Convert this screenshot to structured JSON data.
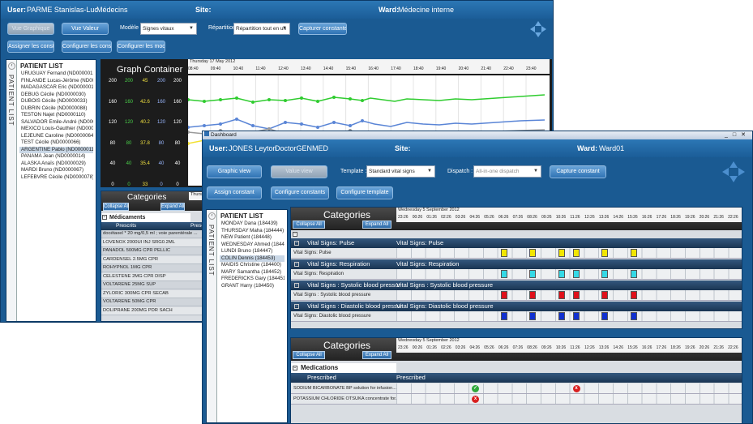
{
  "back": {
    "user_label": "User:",
    "user_value": "PARME Stanislas-Luc",
    "role": "Médecins",
    "site_label": "Site:",
    "ward_label": "Ward:",
    "ward_value": "Médecine interne",
    "btn_graph": "Vue Graphique",
    "btn_value": "Vue Valeur",
    "modele_label": "Modèle :",
    "modele_value": "Signes vitaux",
    "repartition_label": "Répartition",
    "repartition_value": "Répartition tout en un",
    "btn_capture": "Capturer constante",
    "btn_assign": "Assigner les constantes",
    "btn_config_const": "Configurer les constantes",
    "btn_config_models": "Configurer les modèles",
    "patient_tab": "PATIENT LIST",
    "patient_list_title": "PATIENT LIST",
    "patients": [
      "URUGUAY Fernand (ND0000012)",
      "FINLANDE Lucas-Jérôme (ND0000015)",
      "MADAGASCAR Eric (ND0000018)",
      "DEBUG Cécile (ND0000030)",
      "DUBOIS Cécile (ND0000033)",
      "DUBRIN Cécile (ND0000088)",
      "TESTON Najet (ND0000110)",
      "SALVADOR Emile-André (ND0000001)",
      "MEXICO Louis-Gauthier (ND0000013)",
      "LEJEUNE Caroline (ND0000064)",
      "TEST Cécile (ND0000066)",
      "ARGENTINE Pablo (ND0000011)",
      "PANAMA Jean (ND0000014)",
      "ALASKA Anaïs (ND0000029)",
      "MARDI Bruno (ND0000067)",
      "LEFEBVRE Cécile (ND0000078)"
    ],
    "selected_patient": 11,
    "graph_title": "Graph Container",
    "graph_date": "Thursday 17 May 2012",
    "hours": [
      "08:40",
      "09:40",
      "10:40",
      "11:40",
      "12:40",
      "13:40",
      "14:40",
      "15:40",
      "16:40",
      "17:40",
      "18:40",
      "19:40",
      "20:40",
      "21:40",
      "22:40",
      "23:40"
    ],
    "axis_rows": [
      [
        "200",
        "200",
        "45",
        "200",
        "200"
      ],
      [
        "160",
        "160",
        "42.6",
        "160",
        "160"
      ],
      [
        "120",
        "120",
        "40.2",
        "120",
        "120"
      ],
      [
        "80",
        "80",
        "37.8",
        "80",
        "80"
      ],
      [
        "40",
        "40",
        "35.4",
        "40",
        "40"
      ],
      [
        "0",
        "0",
        "33",
        "0",
        "0"
      ]
    ],
    "categories_title": "Categories",
    "collapse_all": "Collapse All",
    "expand_all": "Expand All",
    "cat_date": "Thursday",
    "medicaments_header": "Médicaments",
    "col_prescrits": "Prescrits",
    "col_prescrits2": "Prescrits",
    "meds": [
      "docétaxel * 20 mg/0,5 ml ; voie parentérale ...",
      "LOVENOX 2000UI INJ SRG0.2ML",
      "PANADOL 500MG CPR PELLIC",
      "CARDENSEL 2.5MG CPR",
      "ROHYPNOL 1MG CPR",
      "CELESTENE 2MG CPR DISP",
      "VOLTARENE 25MG SUP",
      "ZYLORIC 300MG CPR SECAB",
      "VOLTARENE 50MG CPR",
      "DOLIPRANE 200MG PDR SACH"
    ]
  },
  "front": {
    "window_title": "Dashboard",
    "user_label": "User:",
    "user_value": "JONES Leyton",
    "role": "DoctorGENMED",
    "site_label": "Site:",
    "ward_label": "Ward:",
    "ward_value": "Ward01",
    "btn_graph": "Graphic view",
    "btn_value": "Value view",
    "template_label": "Template :",
    "template_value": "Standard vital signs",
    "dispatch_label": "Dispatch :",
    "dispatch_value": "All-in-one dispatch",
    "btn_capture": "Capture constant",
    "btn_assign": "Assign constant",
    "btn_config_const": "Configure constants",
    "btn_config_tpl": "Configure template",
    "patient_tab": "PATIENT LIST",
    "patient_list_title": "PATIENT LIST",
    "patients": [
      "MONDAY Dana (184439)",
      "THURSDAY Maha (184444)",
      "NEW Patient (184448)",
      "WEDNESDAY Ahmed (184443)",
      "LUNDI Bruno (184447)",
      "COLIN Dennis (184453)",
      "MAIDIS Christine (184400)",
      "MARY Samantha (184452)",
      "FREDERICKS Gary (184451)",
      "GRANT Harry (184450)"
    ],
    "selected_patient": 5,
    "categories_title": "Categories",
    "collapse_all": "Collapse All",
    "expand_all": "Expand All",
    "date": "Wednesday 5 September 2012",
    "hours": [
      "23:26",
      "00:26",
      "01:26",
      "02:26",
      "03:26",
      "04:26",
      "05:26",
      "06:26",
      "07:26",
      "08:26",
      "09:26",
      "10:26",
      "11:26",
      "12:26",
      "13:26",
      "14:26",
      "15:26",
      "16:26",
      "17:26",
      "18:26",
      "19:26",
      "20:26",
      "21:26",
      "22:26",
      "23:26"
    ],
    "vital_groups": [
      {
        "header_left": "Vital Signs: Pulse",
        "header_right": "Vital Signs: Pulse",
        "row": "Vital Signs: Pulse",
        "color": "#f2e600",
        "cols": [
          7,
          9,
          11,
          12,
          14,
          16
        ]
      },
      {
        "header_left": "Vital Signs: Respiration",
        "header_right": "Vital Signs: Respiration",
        "row": "Vital Signs: Respiration",
        "color": "#35d9e6",
        "cols": [
          7,
          9,
          11,
          12,
          14,
          16
        ]
      },
      {
        "header_left": "Vital Signs : Systolic blood pressur",
        "header_right": "Vital Signs : Systolic blood pressure",
        "row": "Vital Signs : Systolic blood pressure",
        "color": "#e0101a",
        "cols": [
          7,
          9,
          11,
          12,
          14,
          16
        ]
      },
      {
        "header_left": "Vital Signs : Diastolic blood pressur",
        "header_right": "Vital Signs: Diastolic blood pressure",
        "row": "Vital Signs: Diastolic blood pressure",
        "color": "#1030d0",
        "cols": [
          7,
          9,
          11,
          12,
          14,
          16
        ]
      }
    ],
    "medications_header": "Medications",
    "col_prescribed": "Prescribed",
    "col_prescribed2": "Prescribed",
    "medications": [
      {
        "name": "SODIUM BICARBONATE BP solution for infusion...",
        "marks": [
          {
            "col": 5,
            "color": "#2fa83a",
            "text": "✓"
          },
          {
            "col": 12,
            "color": "#d92020",
            "text": "x"
          }
        ]
      },
      {
        "name": "POTASSIUM CHLORIDE OTSUKA concentrate for...",
        "marks": [
          {
            "col": 5,
            "color": "#d92020",
            "text": "x"
          }
        ]
      }
    ]
  }
}
